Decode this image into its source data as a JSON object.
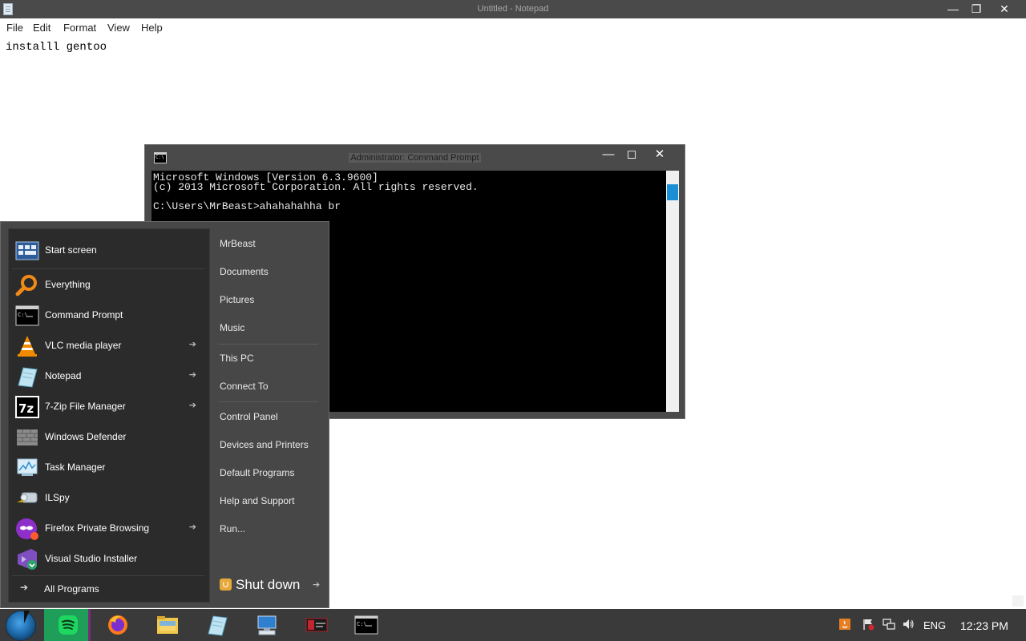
{
  "notepad": {
    "title": "Untitled - Notepad",
    "menus": [
      "File",
      "Edit",
      "Format",
      "View",
      "Help"
    ],
    "content": "installl gentoo",
    "controls": {
      "minimize": "—",
      "maximize": "❐",
      "close": "✕"
    }
  },
  "cmd": {
    "title": "Administrator: Command Prompt",
    "icon_text": "C:\\",
    "lines": [
      "Microsoft Windows [Version 6.3.9600]",
      "(c) 2013 Microsoft Corporation. All rights reserved.",
      "C:\\Users\\MrBeast>ahahahahha br"
    ],
    "controls": {
      "minimize": "—",
      "maximize": "◻",
      "close": "✕"
    }
  },
  "start_menu": {
    "pinned": [
      {
        "label": "Start screen",
        "icon": "start-screen-icon"
      },
      {
        "label": "Everything",
        "icon": "magnifier-icon"
      },
      {
        "label": "Command Prompt",
        "icon": "command-prompt-icon"
      },
      {
        "label": "VLC media player",
        "icon": "vlc-cone-icon",
        "arrow": "➔"
      },
      {
        "label": "Notepad",
        "icon": "notepad-icon",
        "arrow": "➔"
      },
      {
        "label": "7-Zip File Manager",
        "icon": "7zip-icon",
        "icon_text": "7z",
        "arrow": "➔"
      },
      {
        "label": "Windows Defender",
        "icon": "wall-icon"
      },
      {
        "label": "Task Manager",
        "icon": "task-manager-icon"
      },
      {
        "label": "ILSpy",
        "icon": "ilspy-icon"
      },
      {
        "label": "Firefox Private Browsing",
        "icon": "firefox-private-icon",
        "arrow": "➔"
      },
      {
        "label": "Visual Studio Installer",
        "icon": "visual-studio-installer-icon"
      }
    ],
    "all_programs": {
      "label": "All Programs",
      "arrow": "➔"
    },
    "links": [
      "MrBeast",
      "Documents",
      "Pictures",
      "Music",
      "This PC",
      "Connect To",
      "Control Panel",
      "Devices and Printers",
      "Default Programs",
      "Help and Support",
      "Run..."
    ],
    "shutdown": {
      "label": "Shut down",
      "arrow": "➔"
    }
  },
  "taskbar": {
    "apps": [
      "spotify-icon",
      "firefox-icon",
      "file-explorer-icon",
      "notepad-icon",
      "remote-desktop-icon",
      "media-app-icon",
      "command-prompt-icon"
    ],
    "tray": {
      "lang": "ENG",
      "clock": "12:23 PM",
      "icons": [
        "java-icon",
        "action-center-flag-icon",
        "network-icon",
        "volume-icon"
      ]
    }
  },
  "colors": {
    "titlebar": "#4a4a4a",
    "start_menu_bg": "#474747",
    "start_menu_left": "#2b2b2b",
    "taskbar": "#3a3a3a",
    "accent_blue": "#1a8fd6",
    "spotify_green": "#1f9e5a"
  }
}
